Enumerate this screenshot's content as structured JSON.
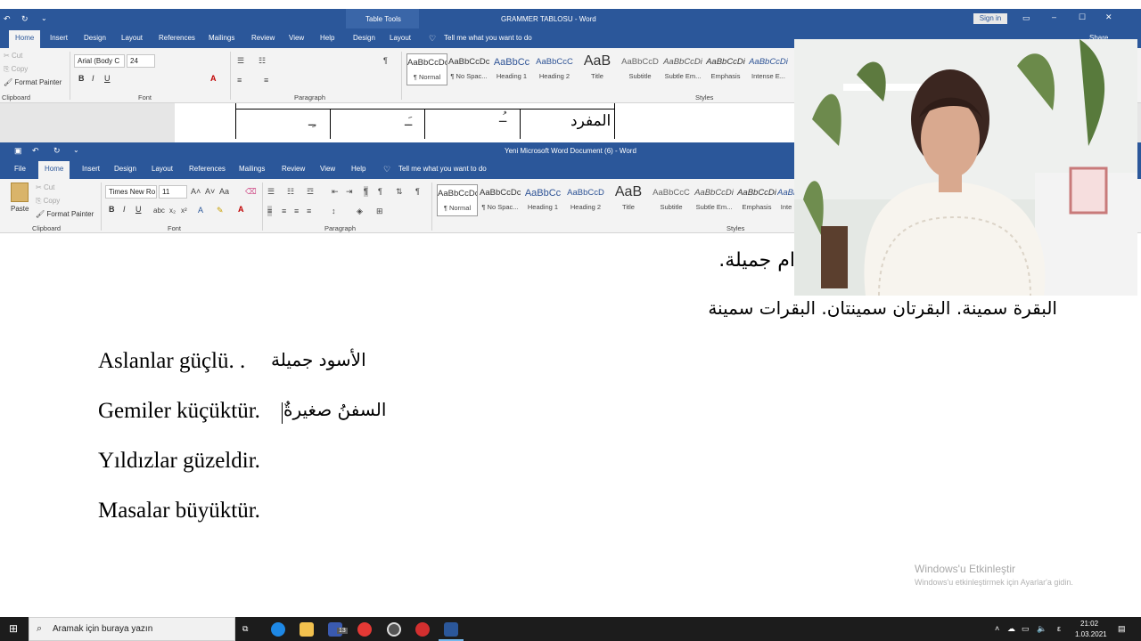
{
  "back_window": {
    "title": "GRAMMER TABLOSU  -  Word",
    "contextual": "Table Tools",
    "signin": "Sign in",
    "share": "Share",
    "tabs": [
      "Home",
      "Insert",
      "Design",
      "Layout",
      "References",
      "Mailings",
      "Review",
      "View",
      "Help",
      "Design",
      "Layout"
    ],
    "tell_me": "Tell me what you want to do",
    "clipboard": {
      "cut": "Cut",
      "copy": "Copy",
      "format_painter": "Format Painter",
      "group": "Clipboard"
    },
    "font": {
      "name": "Arial (Body C",
      "size": "24",
      "group": "Font"
    },
    "paragraph_group": "Paragraph",
    "styles_group": "Styles",
    "styles": [
      {
        "sample": "AaBbCcDc",
        "name": "¶ Normal"
      },
      {
        "sample": "AaBbCcDc",
        "name": "¶ No Spac..."
      },
      {
        "sample": "AaBbCc",
        "name": "Heading 1"
      },
      {
        "sample": "AaBbCcC",
        "name": "Heading 2"
      },
      {
        "sample": "AaB",
        "name": "Title"
      },
      {
        "sample": "AaBbCcD",
        "name": "Subtitle"
      },
      {
        "sample": "AaBbCcDi",
        "name": "Subtle Em..."
      },
      {
        "sample": "AaBbCcDi",
        "name": "Emphasis"
      },
      {
        "sample": "AaBbCcDi",
        "name": "Intense E..."
      }
    ],
    "table_cells": [
      "ـِـ",
      "ـَـ",
      "ـُـ",
      "المفرد"
    ]
  },
  "front_window": {
    "title": "Yeni Microsoft Word Document (6)  -  Word",
    "tabs": [
      "File",
      "Home",
      "Insert",
      "Design",
      "Layout",
      "References",
      "Mailings",
      "Review",
      "View",
      "Help"
    ],
    "tell_me": "Tell me what you want to do",
    "clipboard": {
      "paste": "Paste",
      "cut": "Cut",
      "copy": "Copy",
      "format_painter": "Format Painter",
      "group": "Clipboard"
    },
    "font": {
      "name": "Times New Ro",
      "size": "11",
      "group": "Font"
    },
    "paragraph_group": "Paragraph",
    "styles_group": "Styles",
    "styles": [
      {
        "sample": "AaBbCcDc",
        "name": "¶ Normal"
      },
      {
        "sample": "AaBbCcDc",
        "name": "¶ No Spac..."
      },
      {
        "sample": "AaBbCc",
        "name": "Heading 1"
      },
      {
        "sample": "AaBbCcD",
        "name": "Heading 2"
      },
      {
        "sample": "AaB",
        "name": "Title"
      },
      {
        "sample": "AaBbCcC",
        "name": "Subtitle"
      },
      {
        "sample": "AaBbCcDi",
        "name": "Subtle Em..."
      },
      {
        "sample": "AaBbCcDi",
        "name": "Emphasis"
      },
      {
        "sample": "AaBb",
        "name": "Inte"
      }
    ]
  },
  "document": {
    "arabic_top": "ام جميلة.",
    "arabic_line2": "البقرة سمينة. البقرتان سمينتان. البقرات سمينة",
    "lines": [
      {
        "latin": "Aslanlar güçlü. .",
        "arabic": "الأسود جميلة"
      },
      {
        "latin": "Gemiler küçüktür.",
        "arabic": "السفنُ  صغيرةٌ"
      },
      {
        "latin": "Yıldızlar güzeldir.",
        "arabic": ""
      },
      {
        "latin": "Masalar büyüktür.",
        "arabic": ""
      }
    ]
  },
  "watermark": {
    "title": "Windows'u Etkinleştir",
    "subtitle": "Windows'u etkinleştirmek için Ayarlar'a gidin."
  },
  "taskbar": {
    "search_placeholder": "Aramak için buraya yazın",
    "badge": "13",
    "time": "21:02",
    "date": "1.03.2021",
    "lang": "ε"
  },
  "colors": {
    "word_blue": "#2b579a",
    "taskbar": "#1c1c1c"
  }
}
